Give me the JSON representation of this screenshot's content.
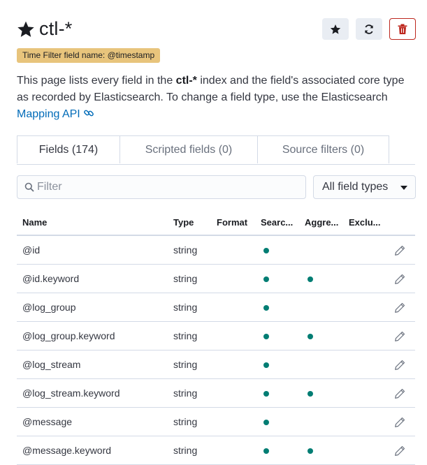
{
  "header": {
    "title": "ctl-*",
    "title_icon": "star-filled-icon",
    "actions": [
      {
        "name": "set-default-button",
        "icon": "star-filled-icon"
      },
      {
        "name": "refresh-fields-button",
        "icon": "refresh-icon"
      },
      {
        "name": "delete-index-pattern-button",
        "icon": "trash-icon"
      }
    ]
  },
  "badge": {
    "text": "Time Filter field name: @timestamp"
  },
  "description": {
    "part1": "This page lists every field in the ",
    "index": "ctl-*",
    "part2": " index and the field's associated core type as recorded by Elasticsearch. To change a field type, use the Elasticsearch ",
    "link_text": "Mapping API"
  },
  "tabs": [
    {
      "label": "Fields (174)",
      "active": true
    },
    {
      "label": "Scripted fields (0)",
      "active": false
    },
    {
      "label": "Source filters (0)",
      "active": false
    }
  ],
  "filter": {
    "placeholder": "Filter",
    "value": ""
  },
  "type_select": {
    "value": "All field types"
  },
  "table": {
    "columns": [
      "Name",
      "Type",
      "Format",
      "Searc...",
      "Aggre...",
      "Exclu..."
    ],
    "rows": [
      {
        "name": "@id",
        "type": "string",
        "format": "",
        "searchable": true,
        "aggregatable": false,
        "excluded": false
      },
      {
        "name": "@id.keyword",
        "type": "string",
        "format": "",
        "searchable": true,
        "aggregatable": true,
        "excluded": false
      },
      {
        "name": "@log_group",
        "type": "string",
        "format": "",
        "searchable": true,
        "aggregatable": false,
        "excluded": false
      },
      {
        "name": "@log_group.keyword",
        "type": "string",
        "format": "",
        "searchable": true,
        "aggregatable": true,
        "excluded": false
      },
      {
        "name": "@log_stream",
        "type": "string",
        "format": "",
        "searchable": true,
        "aggregatable": false,
        "excluded": false
      },
      {
        "name": "@log_stream.keyword",
        "type": "string",
        "format": "",
        "searchable": true,
        "aggregatable": true,
        "excluded": false
      },
      {
        "name": "@message",
        "type": "string",
        "format": "",
        "searchable": true,
        "aggregatable": false,
        "excluded": false
      },
      {
        "name": "@message.keyword",
        "type": "string",
        "format": "",
        "searchable": true,
        "aggregatable": true,
        "excluded": false
      }
    ]
  },
  "colors": {
    "accent_link": "#006bb8",
    "dot": "#017d73",
    "danger": "#bd271e",
    "badge_bg": "#e8c47c"
  }
}
